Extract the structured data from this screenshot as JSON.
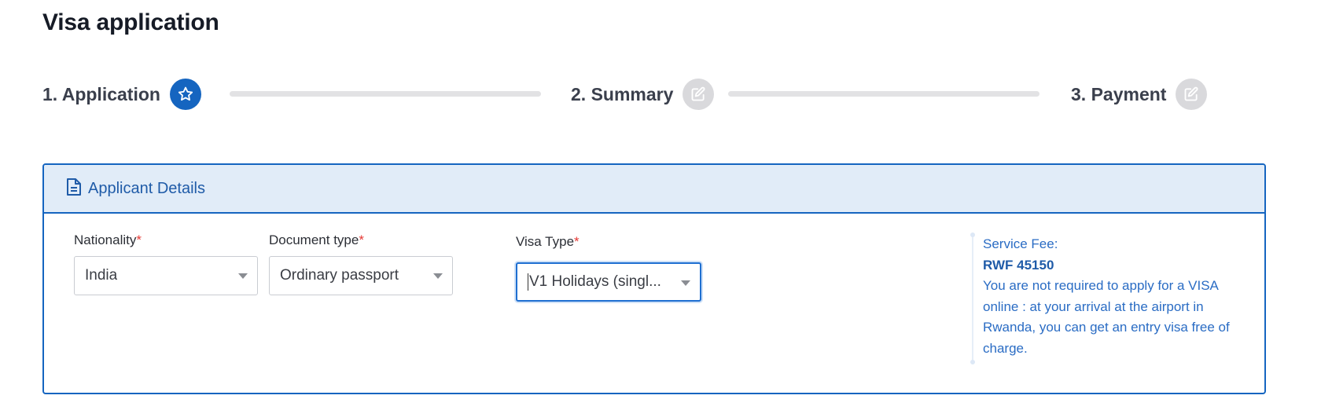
{
  "page": {
    "title": "Visa application"
  },
  "stepper": {
    "steps": [
      {
        "label": "1. Application",
        "icon": "star-icon",
        "state": "active"
      },
      {
        "label": "2. Summary",
        "icon": "edit-icon",
        "state": "inactive"
      },
      {
        "label": "3. Payment",
        "icon": "edit-icon",
        "state": "inactive"
      }
    ]
  },
  "card": {
    "header": {
      "icon": "document-icon",
      "title": "Applicant Details"
    },
    "fields": {
      "nationality": {
        "label": "Nationality",
        "required_mark": "*",
        "value": "India"
      },
      "document_type": {
        "label": "Document type",
        "required_mark": "*",
        "value": "Ordinary passport"
      },
      "visa_type": {
        "label": "Visa Type",
        "required_mark": "*",
        "value": "V1 Holidays (singl..."
      }
    },
    "fee": {
      "label": "Service Fee:",
      "amount": "RWF 45150",
      "note": "You are not required to apply for a VISA online : at your arrival at the airport in Rwanda, you can get an entry visa free of charge."
    }
  },
  "colors": {
    "accent": "#1565c0",
    "header_bg": "#e1ecf8",
    "required": "#e53935",
    "step_inactive": "#d9d9dc"
  }
}
